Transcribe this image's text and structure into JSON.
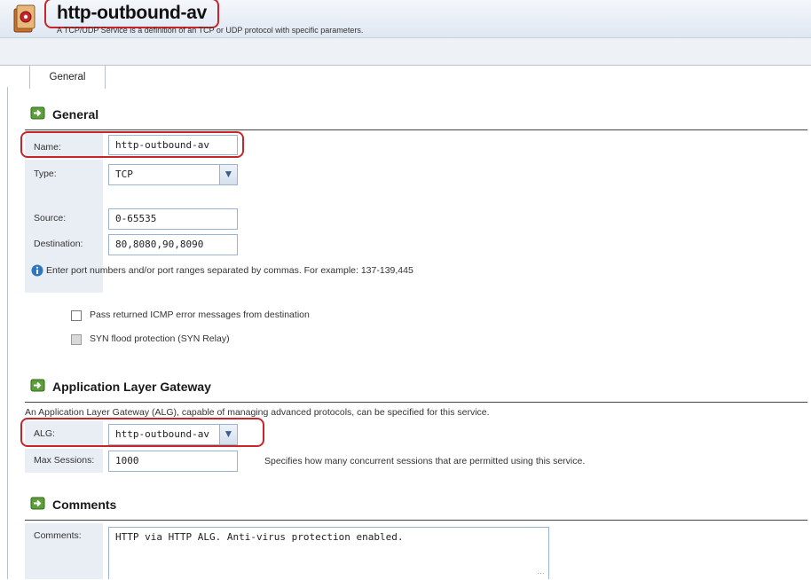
{
  "header": {
    "title": "http-outbound-av",
    "subtitle": "A TCP/UDP Service is a definition of an TCP or UDP protocol with specific parameters.",
    "icon": "service-object-icon"
  },
  "tabs": [
    {
      "label": "General",
      "active": true
    }
  ],
  "general": {
    "section_title": "General",
    "name_label": "Name:",
    "name_value": "http-outbound-av",
    "type_label": "Type:",
    "type_value": "TCP",
    "source_label": "Source:",
    "source_value": "0-65535",
    "destination_label": "Destination:",
    "destination_value": "80,8080,90,8090",
    "info_text": "Enter port numbers and/or port ranges separated by commas. For example: 137-139,445",
    "checkbox_icmp_label": "Pass returned ICMP error messages from destination",
    "checkbox_icmp_checked": false,
    "checkbox_syn_label": "SYN flood protection (SYN Relay)",
    "checkbox_syn_checked": false
  },
  "alg": {
    "section_title": "Application Layer Gateway",
    "description": "An Application Layer Gateway (ALG), capable of managing advanced protocols, can be specified for this service.",
    "alg_label": "ALG:",
    "alg_value": "http-outbound-av",
    "max_sessions_label": "Max Sessions:",
    "max_sessions_value": "1000",
    "max_sessions_hint": "Specifies how many concurrent sessions that are permitted using this service."
  },
  "comments": {
    "section_title": "Comments",
    "label": "Comments:",
    "value": "HTTP via HTTP ALG. Anti-virus protection enabled."
  },
  "colors": {
    "highlight": "#c8252a",
    "label_bg": "#e9eef4",
    "field_border": "#9cb3cf"
  }
}
